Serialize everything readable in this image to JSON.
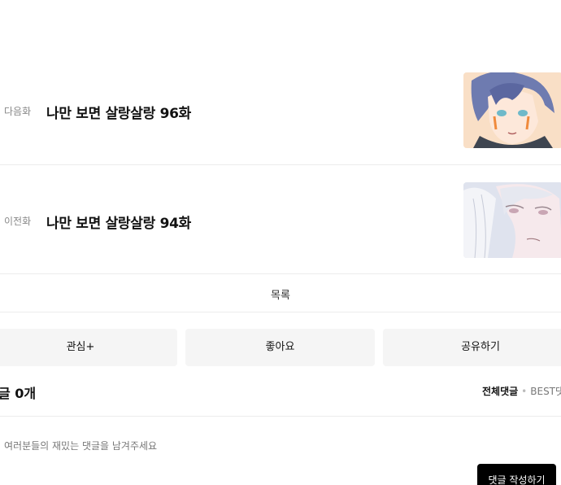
{
  "episodes": {
    "next": {
      "tag": "다음화",
      "title": "나만 보면 살랑살랑 96화"
    },
    "prev": {
      "tag": "이전화",
      "title": "나만 보면 살랑살랑 94화"
    }
  },
  "list_label": "목록",
  "actions": {
    "favorite": "관심+",
    "like": "좋아요",
    "share": "공유하기"
  },
  "comments": {
    "title": "글 0개",
    "sort_all": "전체댓글",
    "sort_best": "BEST댓",
    "input_placeholder": "여러분들의 재밌는 댓글을 남겨주세요",
    "write_button": "댓글 작성하기"
  },
  "colors": {
    "button_bg": "#f5f5f5",
    "write_bg": "#000000",
    "divider": "#ececec"
  }
}
